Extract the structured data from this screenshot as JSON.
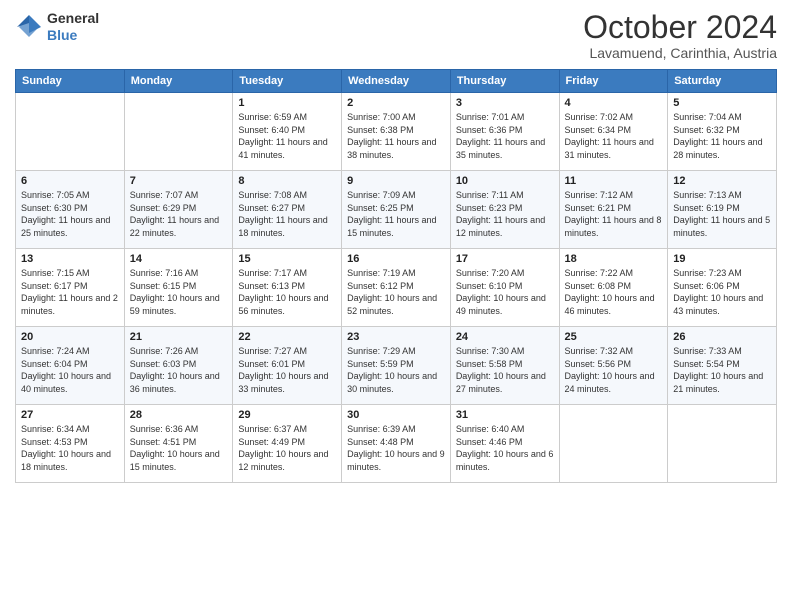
{
  "logo": {
    "general": "General",
    "blue": "Blue"
  },
  "header": {
    "month": "October 2024",
    "location": "Lavamuend, Carinthia, Austria"
  },
  "days_of_week": [
    "Sunday",
    "Monday",
    "Tuesday",
    "Wednesday",
    "Thursday",
    "Friday",
    "Saturday"
  ],
  "weeks": [
    [
      {
        "day": "",
        "sunrise": "",
        "sunset": "",
        "daylight": ""
      },
      {
        "day": "",
        "sunrise": "",
        "sunset": "",
        "daylight": ""
      },
      {
        "day": "1",
        "sunrise": "Sunrise: 6:59 AM",
        "sunset": "Sunset: 6:40 PM",
        "daylight": "Daylight: 11 hours and 41 minutes."
      },
      {
        "day": "2",
        "sunrise": "Sunrise: 7:00 AM",
        "sunset": "Sunset: 6:38 PM",
        "daylight": "Daylight: 11 hours and 38 minutes."
      },
      {
        "day": "3",
        "sunrise": "Sunrise: 7:01 AM",
        "sunset": "Sunset: 6:36 PM",
        "daylight": "Daylight: 11 hours and 35 minutes."
      },
      {
        "day": "4",
        "sunrise": "Sunrise: 7:02 AM",
        "sunset": "Sunset: 6:34 PM",
        "daylight": "Daylight: 11 hours and 31 minutes."
      },
      {
        "day": "5",
        "sunrise": "Sunrise: 7:04 AM",
        "sunset": "Sunset: 6:32 PM",
        "daylight": "Daylight: 11 hours and 28 minutes."
      }
    ],
    [
      {
        "day": "6",
        "sunrise": "Sunrise: 7:05 AM",
        "sunset": "Sunset: 6:30 PM",
        "daylight": "Daylight: 11 hours and 25 minutes."
      },
      {
        "day": "7",
        "sunrise": "Sunrise: 7:07 AM",
        "sunset": "Sunset: 6:29 PM",
        "daylight": "Daylight: 11 hours and 22 minutes."
      },
      {
        "day": "8",
        "sunrise": "Sunrise: 7:08 AM",
        "sunset": "Sunset: 6:27 PM",
        "daylight": "Daylight: 11 hours and 18 minutes."
      },
      {
        "day": "9",
        "sunrise": "Sunrise: 7:09 AM",
        "sunset": "Sunset: 6:25 PM",
        "daylight": "Daylight: 11 hours and 15 minutes."
      },
      {
        "day": "10",
        "sunrise": "Sunrise: 7:11 AM",
        "sunset": "Sunset: 6:23 PM",
        "daylight": "Daylight: 11 hours and 12 minutes."
      },
      {
        "day": "11",
        "sunrise": "Sunrise: 7:12 AM",
        "sunset": "Sunset: 6:21 PM",
        "daylight": "Daylight: 11 hours and 8 minutes."
      },
      {
        "day": "12",
        "sunrise": "Sunrise: 7:13 AM",
        "sunset": "Sunset: 6:19 PM",
        "daylight": "Daylight: 11 hours and 5 minutes."
      }
    ],
    [
      {
        "day": "13",
        "sunrise": "Sunrise: 7:15 AM",
        "sunset": "Sunset: 6:17 PM",
        "daylight": "Daylight: 11 hours and 2 minutes."
      },
      {
        "day": "14",
        "sunrise": "Sunrise: 7:16 AM",
        "sunset": "Sunset: 6:15 PM",
        "daylight": "Daylight: 10 hours and 59 minutes."
      },
      {
        "day": "15",
        "sunrise": "Sunrise: 7:17 AM",
        "sunset": "Sunset: 6:13 PM",
        "daylight": "Daylight: 10 hours and 56 minutes."
      },
      {
        "day": "16",
        "sunrise": "Sunrise: 7:19 AM",
        "sunset": "Sunset: 6:12 PM",
        "daylight": "Daylight: 10 hours and 52 minutes."
      },
      {
        "day": "17",
        "sunrise": "Sunrise: 7:20 AM",
        "sunset": "Sunset: 6:10 PM",
        "daylight": "Daylight: 10 hours and 49 minutes."
      },
      {
        "day": "18",
        "sunrise": "Sunrise: 7:22 AM",
        "sunset": "Sunset: 6:08 PM",
        "daylight": "Daylight: 10 hours and 46 minutes."
      },
      {
        "day": "19",
        "sunrise": "Sunrise: 7:23 AM",
        "sunset": "Sunset: 6:06 PM",
        "daylight": "Daylight: 10 hours and 43 minutes."
      }
    ],
    [
      {
        "day": "20",
        "sunrise": "Sunrise: 7:24 AM",
        "sunset": "Sunset: 6:04 PM",
        "daylight": "Daylight: 10 hours and 40 minutes."
      },
      {
        "day": "21",
        "sunrise": "Sunrise: 7:26 AM",
        "sunset": "Sunset: 6:03 PM",
        "daylight": "Daylight: 10 hours and 36 minutes."
      },
      {
        "day": "22",
        "sunrise": "Sunrise: 7:27 AM",
        "sunset": "Sunset: 6:01 PM",
        "daylight": "Daylight: 10 hours and 33 minutes."
      },
      {
        "day": "23",
        "sunrise": "Sunrise: 7:29 AM",
        "sunset": "Sunset: 5:59 PM",
        "daylight": "Daylight: 10 hours and 30 minutes."
      },
      {
        "day": "24",
        "sunrise": "Sunrise: 7:30 AM",
        "sunset": "Sunset: 5:58 PM",
        "daylight": "Daylight: 10 hours and 27 minutes."
      },
      {
        "day": "25",
        "sunrise": "Sunrise: 7:32 AM",
        "sunset": "Sunset: 5:56 PM",
        "daylight": "Daylight: 10 hours and 24 minutes."
      },
      {
        "day": "26",
        "sunrise": "Sunrise: 7:33 AM",
        "sunset": "Sunset: 5:54 PM",
        "daylight": "Daylight: 10 hours and 21 minutes."
      }
    ],
    [
      {
        "day": "27",
        "sunrise": "Sunrise: 6:34 AM",
        "sunset": "Sunset: 4:53 PM",
        "daylight": "Daylight: 10 hours and 18 minutes."
      },
      {
        "day": "28",
        "sunrise": "Sunrise: 6:36 AM",
        "sunset": "Sunset: 4:51 PM",
        "daylight": "Daylight: 10 hours and 15 minutes."
      },
      {
        "day": "29",
        "sunrise": "Sunrise: 6:37 AM",
        "sunset": "Sunset: 4:49 PM",
        "daylight": "Daylight: 10 hours and 12 minutes."
      },
      {
        "day": "30",
        "sunrise": "Sunrise: 6:39 AM",
        "sunset": "Sunset: 4:48 PM",
        "daylight": "Daylight: 10 hours and 9 minutes."
      },
      {
        "day": "31",
        "sunrise": "Sunrise: 6:40 AM",
        "sunset": "Sunset: 4:46 PM",
        "daylight": "Daylight: 10 hours and 6 minutes."
      },
      {
        "day": "",
        "sunrise": "",
        "sunset": "",
        "daylight": ""
      },
      {
        "day": "",
        "sunrise": "",
        "sunset": "",
        "daylight": ""
      }
    ]
  ]
}
